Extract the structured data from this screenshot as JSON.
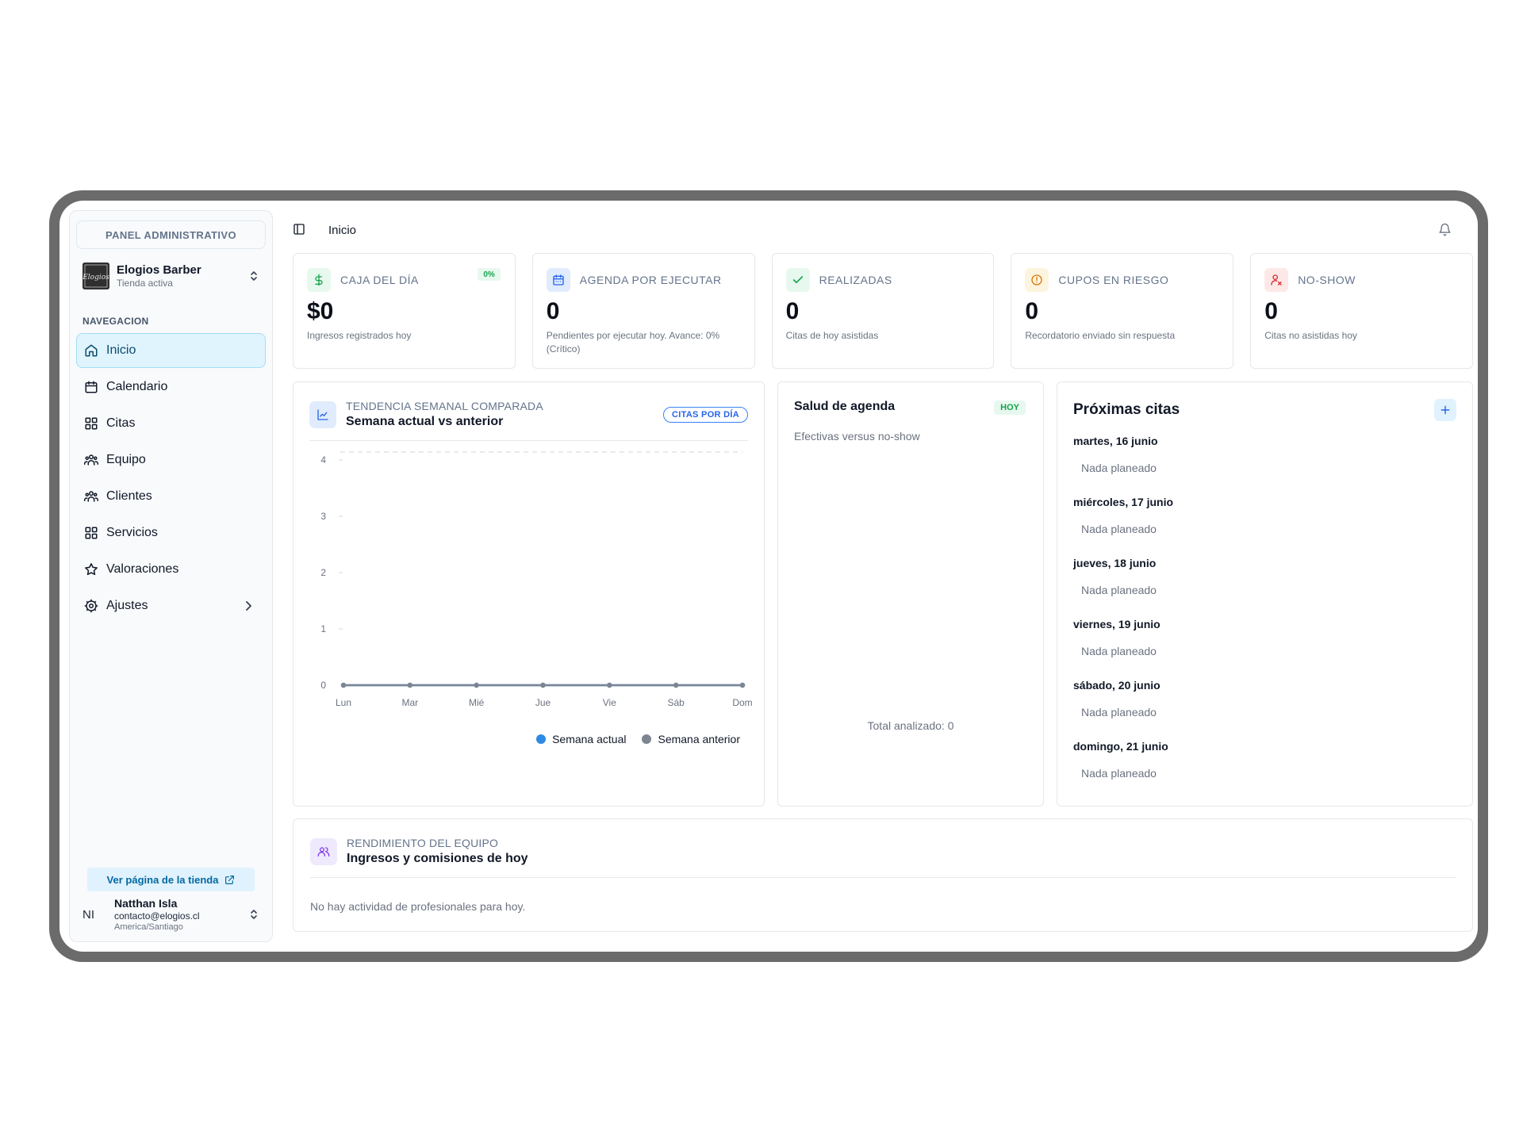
{
  "sidebar": {
    "panel_label": "PANEL ADMINISTRATIVO",
    "store_name": "Elogios Barber",
    "store_status": "Tienda activa",
    "store_logo_text": "Elogios",
    "nav_title": "NAVEGACION",
    "items": [
      {
        "label": "Inicio",
        "icon": "home-icon",
        "active": true
      },
      {
        "label": "Calendario",
        "icon": "calendar-icon"
      },
      {
        "label": "Citas",
        "icon": "grid-icon"
      },
      {
        "label": "Equipo",
        "icon": "users-icon"
      },
      {
        "label": "Clientes",
        "icon": "users-icon"
      },
      {
        "label": "Servicios",
        "icon": "grid-icon"
      },
      {
        "label": "Valoraciones",
        "icon": "star-icon"
      },
      {
        "label": "Ajustes",
        "icon": "gear-icon",
        "has_submenu": true
      }
    ],
    "store_link_label": "Ver página de la tienda",
    "user": {
      "initials": "NI",
      "name": "Natthan Isla",
      "email": "contacto@elogios.cl",
      "timezone": "America/Santiago"
    }
  },
  "topbar": {
    "breadcrumb": "Inicio"
  },
  "kpis": [
    {
      "label": "CAJA DEL DÍA",
      "value": "$0",
      "desc": "Ingresos registrados hoy",
      "badge": "0%",
      "icon": "dollar-icon",
      "color": "#16a34a",
      "bg": "#e7f8ef"
    },
    {
      "label": "AGENDA POR EJECUTAR",
      "value": "0",
      "desc": "Pendientes por ejecutar hoy. Avance: 0% (Crítico)",
      "icon": "calendar-icon",
      "color": "#2563eb",
      "bg": "#e0ecfd"
    },
    {
      "label": "REALIZADAS",
      "value": "0",
      "desc": "Citas de hoy asistidas",
      "icon": "check-icon",
      "color": "#16a34a",
      "bg": "#e7f8ef"
    },
    {
      "label": "CUPOS EN RIESGO",
      "value": "0",
      "desc": "Recordatorio enviado sin respuesta",
      "icon": "alert-icon",
      "color": "#d97706",
      "bg": "#fdf4df"
    },
    {
      "label": "NO-SHOW",
      "value": "0",
      "desc": "Citas no asistidas hoy",
      "icon": "user-x-icon",
      "color": "#dc2626",
      "bg": "#fde8e8"
    }
  ],
  "trend": {
    "kicker": "TENDENCIA SEMANAL COMPARADA",
    "title": "Semana actual vs anterior",
    "pill": "CITAS POR DÍA"
  },
  "chart_data": {
    "type": "line",
    "categories": [
      "Lun",
      "Mar",
      "Mié",
      "Jue",
      "Vie",
      "Sáb",
      "Dom"
    ],
    "series": [
      {
        "name": "Semana actual",
        "values": [
          0,
          0,
          0,
          0,
          0,
          0,
          0
        ],
        "color": "#2f8ae6"
      },
      {
        "name": "Semana anterior",
        "values": [
          0,
          0,
          0,
          0,
          0,
          0,
          0
        ],
        "color": "#7d8591"
      }
    ],
    "ylim": [
      0,
      4
    ],
    "yticks": [
      0,
      1,
      2,
      3,
      4
    ],
    "grid": false,
    "legend": "bottom-right"
  },
  "health": {
    "title": "Salud de agenda",
    "badge": "HOY",
    "subtitle": "Efectivas versus no-show",
    "total": "Total analizado: 0"
  },
  "upcoming": {
    "title": "Próximas citas",
    "days": [
      {
        "date": "martes, 16 junio",
        "status": "Nada planeado"
      },
      {
        "date": "miércoles, 17 junio",
        "status": "Nada planeado"
      },
      {
        "date": "jueves, 18 junio",
        "status": "Nada planeado"
      },
      {
        "date": "viernes, 19 junio",
        "status": "Nada planeado"
      },
      {
        "date": "sábado, 20 junio",
        "status": "Nada planeado"
      },
      {
        "date": "domingo, 21 junio",
        "status": "Nada planeado"
      }
    ]
  },
  "team": {
    "kicker": "RENDIMIENTO DEL EQUIPO",
    "title": "Ingresos y comisiones de hoy",
    "empty": "No hay actividad de profesionales para hoy."
  },
  "colors": {
    "accent": "#2563eb",
    "active_nav_bg": "#dff4fd",
    "success": "#16a34a"
  }
}
